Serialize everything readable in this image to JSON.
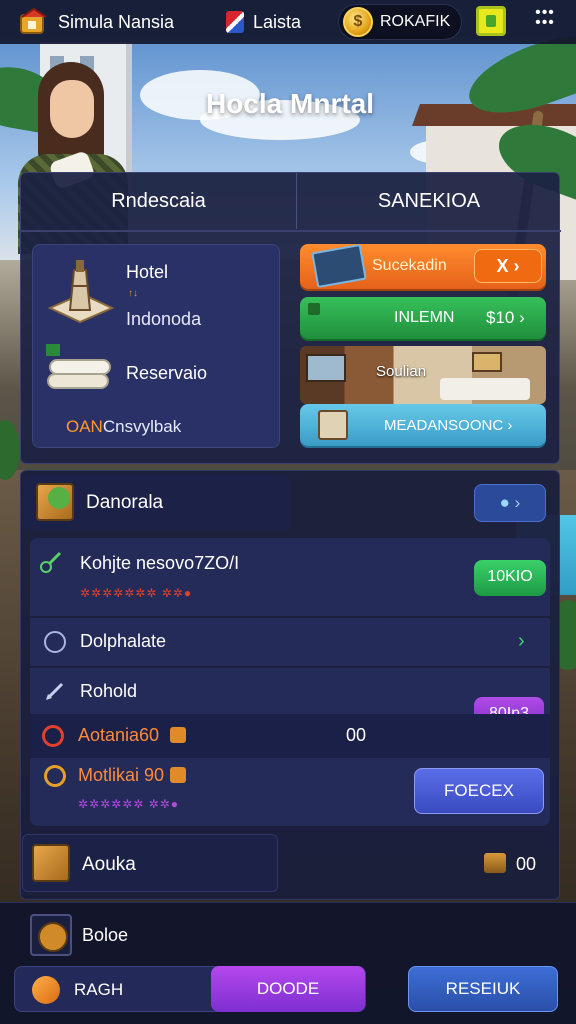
{
  "topbar": {
    "app_title": "Simula Nansia",
    "language": "Laista",
    "coin_value": "ROKAFIK"
  },
  "hero": {
    "title": "Hocla Mnrtal"
  },
  "tabs": [
    {
      "label": "Rndescaia"
    },
    {
      "label": "SANEKIOA"
    }
  ],
  "left_card": {
    "hotel_label": "Hotel",
    "tiny_text": "↑↓",
    "location": "Indonoda",
    "reservation_label": "Reservaio",
    "bottom_prefix": "OAN",
    "bottom_label": "Cnsvylbak"
  },
  "actions": {
    "orange": {
      "label": "Sucekadin",
      "chip": "X ›"
    },
    "green": {
      "label": "INLEMN",
      "value": "$10 ›"
    },
    "room": {
      "label": "Soulian"
    },
    "cyan": {
      "label": "MEADANSOONC ›"
    }
  },
  "list": {
    "header": {
      "label": "Danorala",
      "button": "● ›"
    },
    "rows": [
      {
        "title": "Kohjte nesovo7ZO/I",
        "sub": "✲✲✲✲✲✲✲ ✲✲●",
        "button": "10KIO"
      },
      {
        "title": "Dolphalate",
        "chevron": "›"
      },
      {
        "title": "Rohold",
        "button": "80In3"
      },
      {
        "title": "Aotania60",
        "value": "00"
      },
      {
        "title": "Motlikai 90",
        "sub": "✲✲✲✲✲✲ ✲✲●",
        "button": "FOECEX"
      }
    ],
    "bottom": {
      "label": "Aouka",
      "value": "00"
    }
  },
  "footer": {
    "section_label": "Boloe",
    "left_tab": "RAGH",
    "mid_tab": "DOODE",
    "right_button": "RESEIUK"
  },
  "colors": {
    "panel": "#1c2242",
    "accent_orange": "#ff8c2e",
    "accent_green": "#2fb54f",
    "accent_purple": "#9a3fe0",
    "accent_blue": "#3a5fd0"
  }
}
